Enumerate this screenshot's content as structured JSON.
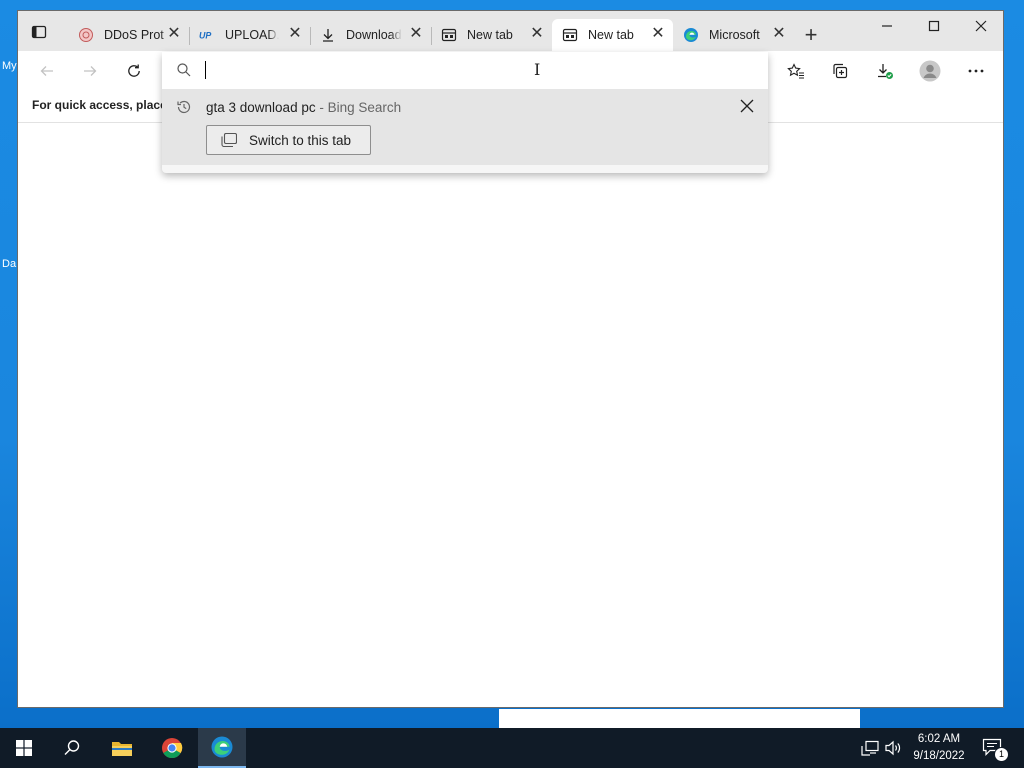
{
  "desktop": {
    "labels": [
      "My",
      "Da"
    ]
  },
  "tabs": [
    {
      "title": "DDoS Prot",
      "icon": "ddos-favicon"
    },
    {
      "title": "UPLOAD.EE",
      "icon": "upload-ee-favicon"
    },
    {
      "title": "Downloads",
      "icon": "download-arrow-icon"
    },
    {
      "title": "New tab",
      "icon": "new-tab-page-icon"
    },
    {
      "title": "New tab",
      "icon": "new-tab-page-icon",
      "active": true
    },
    {
      "title": "Microsoft",
      "icon": "edge-logo-icon"
    }
  ],
  "tab_close_glyph": "✕",
  "new_tab_glyph": "+",
  "favorites_bar": {
    "text": "For quick access, place y"
  },
  "omnibox": {
    "value": "",
    "suggestion": {
      "query": "gta 3 download pc",
      "source": " - Bing Search",
      "action_label": "Switch to this tab"
    }
  },
  "taskbar": {
    "time": "6:02 AM",
    "date": "9/18/2022",
    "notification_count": "1"
  },
  "colors": {
    "desktop_blue": "#1b8be3",
    "taskbar": "#101b27",
    "tabstrip": "#e7e7e7"
  }
}
